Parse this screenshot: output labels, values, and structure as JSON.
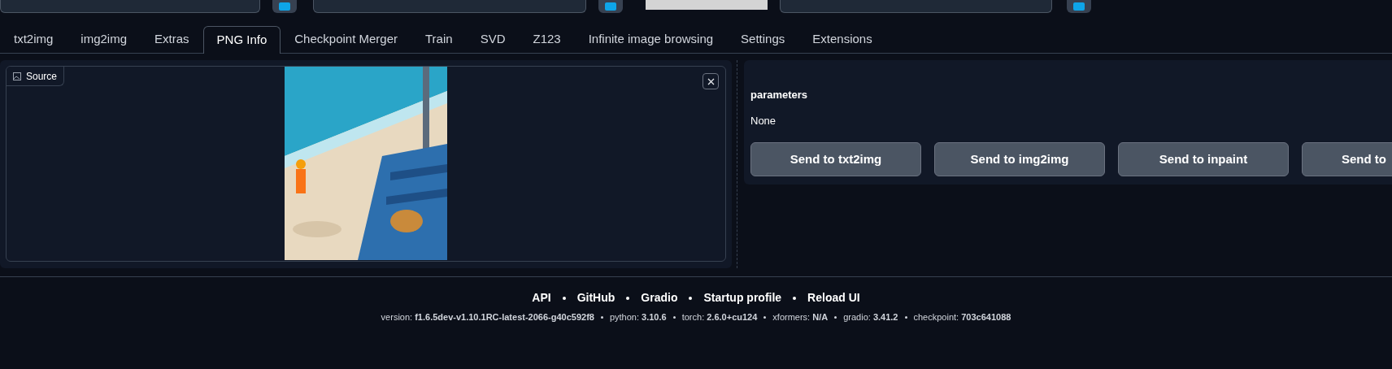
{
  "tabs": [
    {
      "label": "txt2img",
      "selected": false
    },
    {
      "label": "img2img",
      "selected": false
    },
    {
      "label": "Extras",
      "selected": false
    },
    {
      "label": "PNG Info",
      "selected": true
    },
    {
      "label": "Checkpoint Merger",
      "selected": false
    },
    {
      "label": "Train",
      "selected": false
    },
    {
      "label": "SVD",
      "selected": false
    },
    {
      "label": "Z123",
      "selected": false
    },
    {
      "label": "Infinite image browsing",
      "selected": false
    },
    {
      "label": "Settings",
      "selected": false
    },
    {
      "label": "Extensions",
      "selected": false
    }
  ],
  "source": {
    "label": "Source"
  },
  "info": {
    "heading": "parameters",
    "value": "None"
  },
  "send_buttons": [
    "Send to txt2img",
    "Send to img2img",
    "Send to inpaint",
    "Send to"
  ],
  "footer": {
    "links": [
      "API",
      "GitHub",
      "Gradio",
      "Startup profile",
      "Reload UI"
    ],
    "versions": [
      "version: **f1.6.5dev-v1.10.1RC-latest-2066-g40c592f8**",
      "python: **3.10.6**",
      "torch: **2.6.0+cu124**",
      "xformers: **N/A**",
      "gradio: **3.41.2**",
      "checkpoint: **703c641088**"
    ]
  }
}
